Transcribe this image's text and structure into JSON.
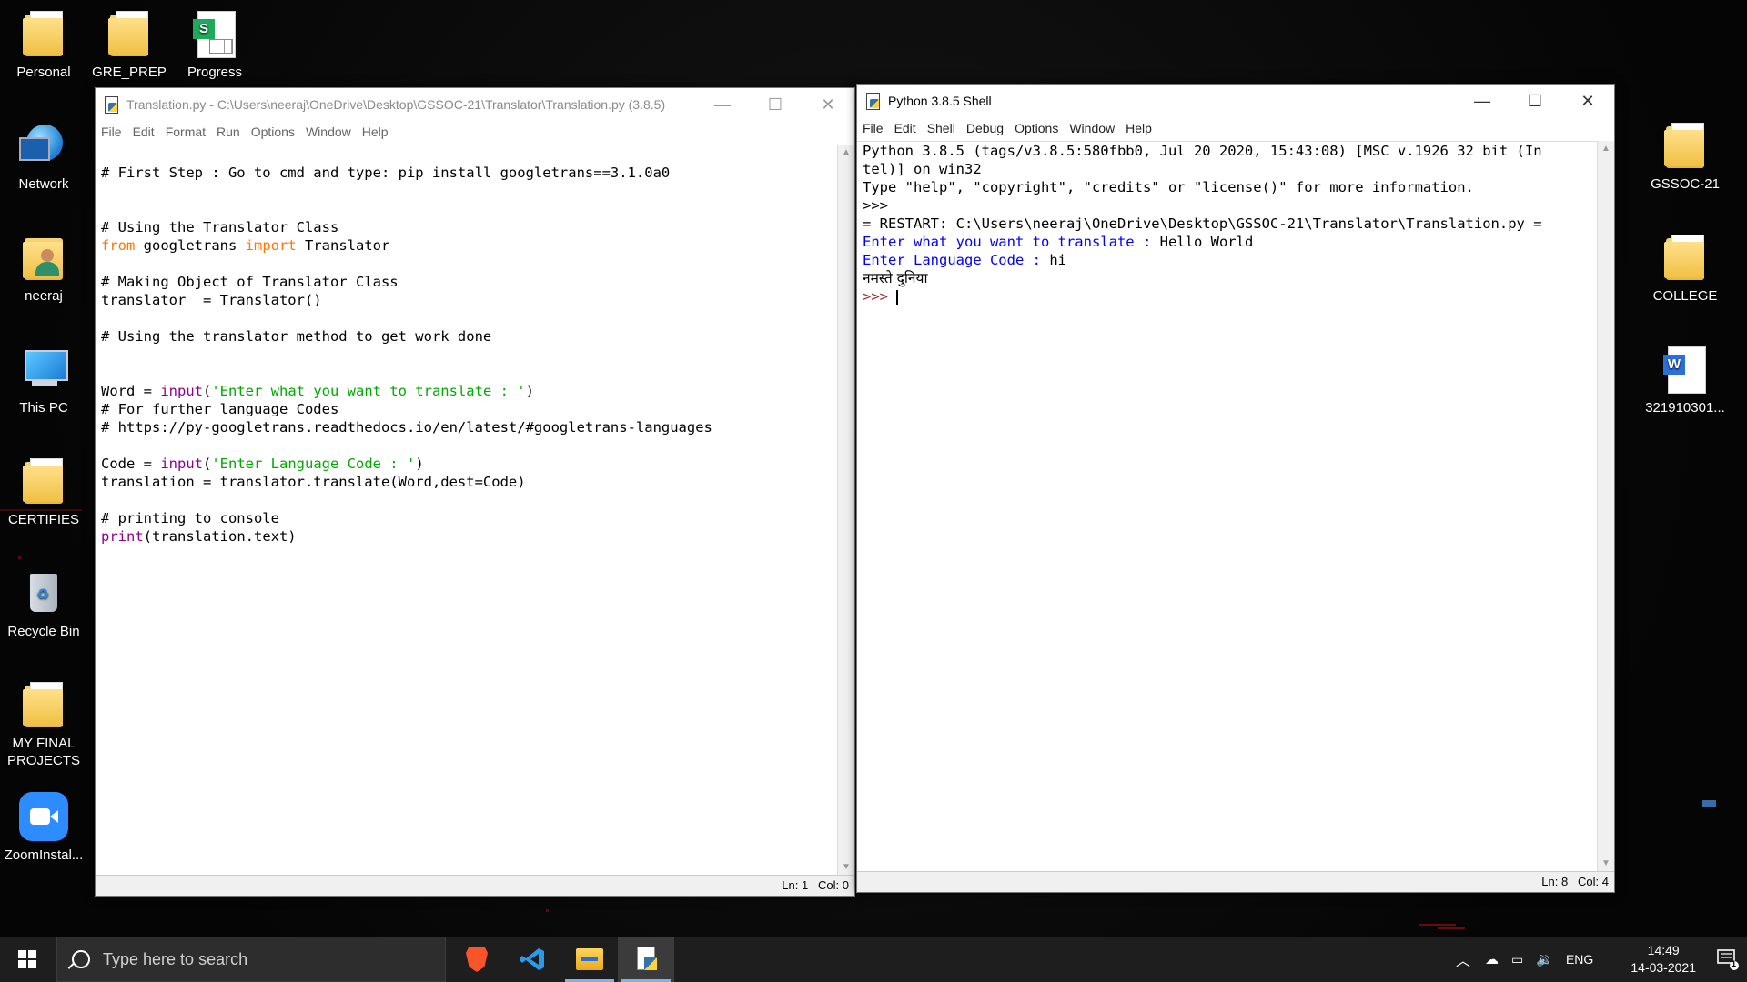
{
  "desktop": {
    "icons": {
      "personal": "Personal",
      "gre_prep": "GRE_PREP",
      "progress": "Progress",
      "network": "Network",
      "neeraj": "neeraj",
      "this_pc": "This PC",
      "certifies": "CERTIFIES",
      "recycle_bin": "Recycle Bin",
      "my_final_projects": "MY FINAL PROJECTS",
      "zoom": "ZoomInstal...",
      "gssoc": "GSSOC-21",
      "college": "COLLEGE",
      "doc": "321910301..."
    }
  },
  "editor_window": {
    "title": "Translation.py - C:\\Users\\neeraj\\OneDrive\\Desktop\\GSSOC-21\\Translator\\Translation.py (3.8.5)",
    "menu": [
      "File",
      "Edit",
      "Format",
      "Run",
      "Options",
      "Window",
      "Help"
    ],
    "code": {
      "l1": "# First Step : Go to cmd and type: pip install googletrans==3.1.0a0",
      "l4": "# Using the Translator Class",
      "l5_kw1": "from",
      "l5_mod": " googletrans ",
      "l5_kw2": "import",
      "l5_cls": " Translator",
      "l7": "# Making Object of Translator Class",
      "l8": "translator  = Translator()",
      "l10": "# Using the translator method to get work done",
      "l13_a": "Word = ",
      "l13_fn": "input",
      "l13_b": "(",
      "l13_str": "'Enter what you want to translate : '",
      "l13_c": ")",
      "l14": "# For further language Codes",
      "l15": "# https://py-googletrans.readthedocs.io/en/latest/#googletrans-languages",
      "l17_a": "Code = ",
      "l17_fn": "input",
      "l17_b": "(",
      "l17_str": "'Enter Language Code : '",
      "l17_c": ")",
      "l18": "translation = translator.translate(Word,dest=Code)",
      "l20": "# printing to console",
      "l21_fn": "print",
      "l21_rest": "(translation.text)"
    },
    "status": "Ln: 1   Col: 0"
  },
  "shell_window": {
    "title": "Python 3.8.5 Shell",
    "menu": [
      "File",
      "Edit",
      "Shell",
      "Debug",
      "Options",
      "Window",
      "Help"
    ],
    "lines": {
      "l1": "Python 3.8.5 (tags/v3.8.5:580fbb0, Jul 20 2020, 15:43:08) [MSC v.1926 32 bit (In",
      "l2": "tel)] on win32",
      "l3": "Type \"help\", \"copyright\", \"credits\" or \"license()\" for more information.",
      "l4": ">>>",
      "l5": "= RESTART: C:\\Users\\neeraj\\OneDrive\\Desktop\\GSSOC-21\\Translator\\Translation.py =",
      "l6_prompt": "Enter what you want to translate : ",
      "l6_input": "Hello World",
      "l7_prompt": "Enter Language Code : ",
      "l7_input": "hi",
      "l8": "नमस्ते दुनिया",
      "l9": ">>> "
    },
    "status": "Ln: 8   Col: 4"
  },
  "taskbar": {
    "search_placeholder": "Type here to search",
    "apps": [
      "brave-browser",
      "vscode",
      "file-explorer",
      "python-idle"
    ],
    "language": "ENG",
    "time": "14:49",
    "date": "14-03-2021",
    "notification_count": "1"
  }
}
